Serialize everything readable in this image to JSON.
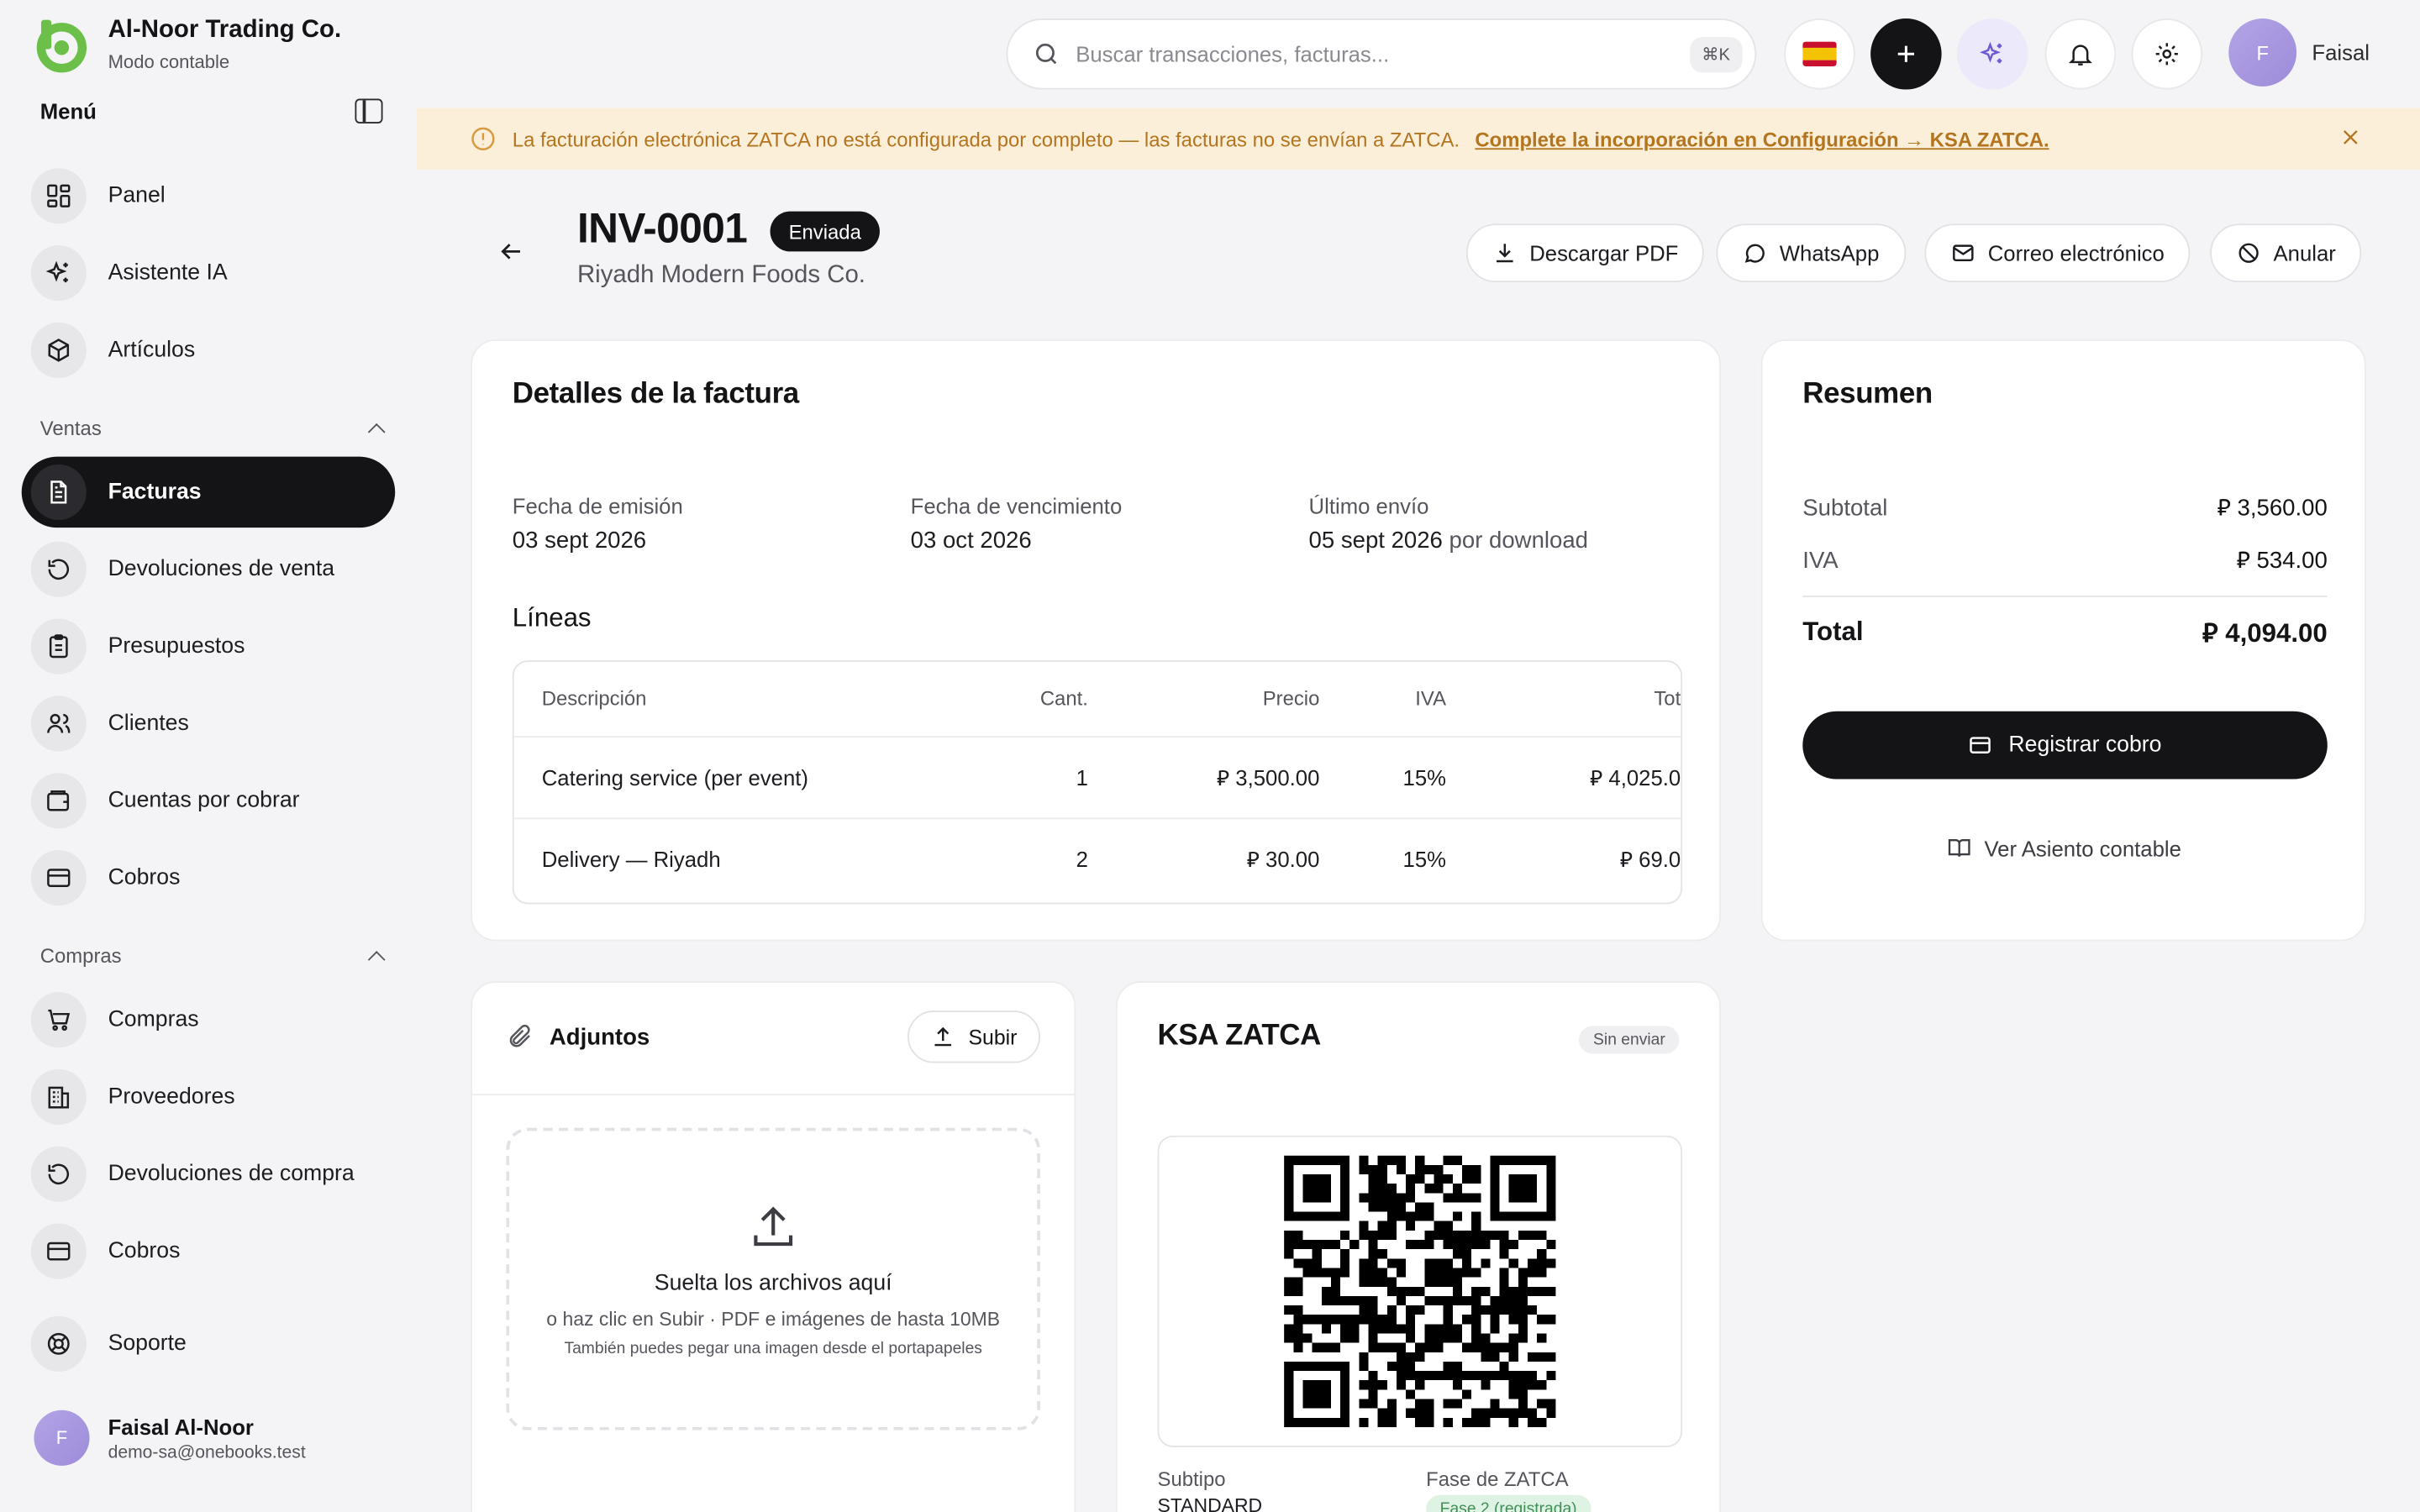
{
  "brand": {
    "name": "Al-Noor Trading Co.",
    "subtitle": "Modo contable"
  },
  "sidebar": {
    "menu_label": "Menú",
    "top_items": [
      {
        "label": "Panel",
        "icon": "grid-icon"
      },
      {
        "label": "Asistente IA",
        "icon": "sparkles-icon"
      },
      {
        "label": "Artículos",
        "icon": "box-icon"
      }
    ],
    "sales_label": "Ventas",
    "sales_items": [
      {
        "label": "Facturas",
        "icon": "invoice-icon",
        "active": true
      },
      {
        "label": "Devoluciones de venta",
        "icon": "return-icon"
      },
      {
        "label": "Presupuestos",
        "icon": "clipboard-icon"
      },
      {
        "label": "Clientes",
        "icon": "users-icon"
      },
      {
        "label": "Cuentas por cobrar",
        "icon": "wallet-icon"
      },
      {
        "label": "Cobros",
        "icon": "card-icon"
      }
    ],
    "purchases_label": "Compras",
    "purchase_items": [
      {
        "label": "Compras",
        "icon": "cart-icon"
      },
      {
        "label": "Proveedores",
        "icon": "building-icon"
      },
      {
        "label": "Devoluciones de compra",
        "icon": "return-icon"
      },
      {
        "label": "Cobros",
        "icon": "card-icon"
      }
    ],
    "support_label": "Soporte",
    "user": {
      "initial": "F",
      "name": "Faisal Al-Noor",
      "email": "demo-sa@onebooks.test"
    }
  },
  "topbar": {
    "search_placeholder": "Buscar transacciones, facturas...",
    "search_shortcut": "⌘K",
    "user_initial": "F",
    "user_name": "Faisal"
  },
  "banner": {
    "text": "La facturación electrónica ZATCA no está configurada por completo — las facturas no se envían a ZATCA.",
    "link": "Complete la incorporación en Configuración → KSA ZATCA."
  },
  "invoice": {
    "number": "INV-0001",
    "status": "Enviada",
    "customer": "Riyadh Modern Foods Co.",
    "actions": {
      "pdf": "Descargar PDF",
      "whatsapp": "WhatsApp",
      "email": "Correo electrónico",
      "void": "Anular"
    }
  },
  "details": {
    "title": "Detalles de la factura",
    "issue_label": "Fecha de emisión",
    "issue_value": "03 sept 2026",
    "due_label": "Fecha de vencimiento",
    "due_value": "03 oct 2026",
    "last_sent_label": "Último envío",
    "last_sent_value": "05 sept 2026",
    "last_sent_by": "por download",
    "lines_title": "Líneas",
    "columns": [
      "Descripción",
      "Cant.",
      "Precio",
      "IVA",
      "Tot"
    ],
    "rows": [
      {
        "desc": "Catering service (per event)",
        "qty": "1",
        "price": "3,500.00",
        "vat": "15%",
        "total": "4,025.0"
      },
      {
        "desc": "Delivery — Riyadh",
        "qty": "2",
        "price": "30.00",
        "vat": "15%",
        "total": "69.0"
      }
    ]
  },
  "summary": {
    "title": "Resumen",
    "subtotal_label": "Subtotal",
    "subtotal_value": "3,560.00",
    "vat_label": "IVA",
    "vat_value": "534.00",
    "total_label": "Total",
    "total_value": "4,094.00",
    "pay_button": "Registrar cobro",
    "journal_link": "Ver Asiento contable"
  },
  "attachments": {
    "title": "Adjuntos",
    "upload_button": "Subir",
    "drop_title": "Suelta los archivos aquí",
    "drop_hint": "o haz clic en Subir · PDF e imágenes de hasta 10MB",
    "drop_paste": "También puedes pegar una imagen desde el portapapeles"
  },
  "zatca": {
    "title": "KSA ZATCA",
    "status": "Sin enviar",
    "subtype_label": "Subtipo",
    "subtype_value": "STANDARD",
    "phase_label": "Fase de ZATCA",
    "phase_value": "Fase 2 (registrada)"
  },
  "colors": {
    "accent_green": "#6cc04a",
    "dark": "#141416",
    "warning_bg": "#fcefd9",
    "warning_text": "#b3751f"
  }
}
